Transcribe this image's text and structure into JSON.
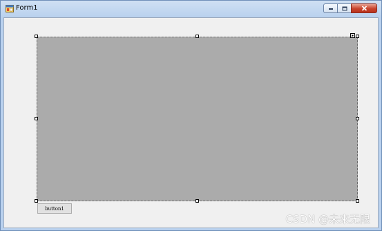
{
  "window": {
    "title": "Form1",
    "icon": "winforms-form-icon",
    "caption_buttons": [
      "minimize-icon",
      "maximize-icon",
      "close-icon"
    ]
  },
  "form": {
    "panel_color": "#ababab",
    "button_label": "button1"
  },
  "watermark": {
    "text": "CSDN @未来无限"
  }
}
